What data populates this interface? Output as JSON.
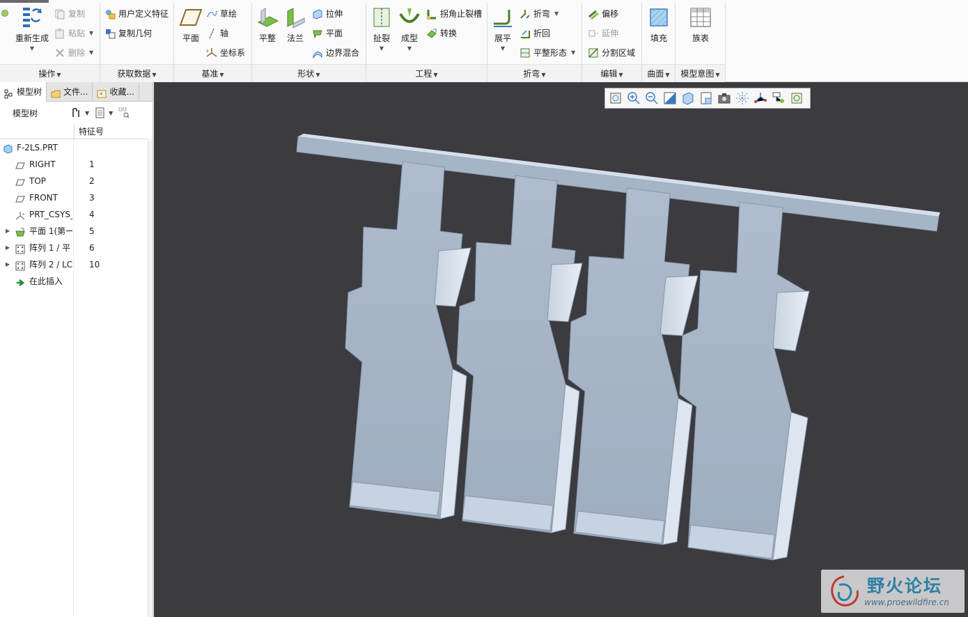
{
  "ribbon": {
    "groups": [
      {
        "label": "操作"
      },
      {
        "label": "获取数据"
      },
      {
        "label": "基准"
      },
      {
        "label": "形状"
      },
      {
        "label": "工程"
      },
      {
        "label": "折弯"
      },
      {
        "label": "编辑"
      },
      {
        "label": "曲面"
      },
      {
        "label": "模型意图"
      }
    ],
    "ops": {
      "regenerate": "重新生成",
      "copy": "复制",
      "paste": "粘贴",
      "delete": "删除"
    },
    "getdata": {
      "udf": "用户定义特征",
      "copy_geom": "复制几何"
    },
    "datum": {
      "plane": "平面",
      "sketch": "草绘",
      "axis": "轴",
      "csys": "坐标系"
    },
    "shapes": {
      "flat": "平整",
      "flange": "法兰",
      "extrude": "拉伸",
      "plane": "平面",
      "boundary_blend": "边界混合"
    },
    "engineering": {
      "rip": "扯裂",
      "form": "成型",
      "corner_relief": "拐角止裂槽",
      "convert": "转换"
    },
    "bend": {
      "unbend": "展平",
      "bend": "折弯",
      "bend_back": "折回",
      "flat_state": "平整形态"
    },
    "edit": {
      "offset": "偏移",
      "extend": "延伸",
      "split_area": "分割区域"
    },
    "surface": {
      "fill": "填充"
    },
    "intent": {
      "family_table": "族表"
    }
  },
  "panel": {
    "tabs": [
      "模型树",
      "文件...",
      "收藏..."
    ],
    "toolbar_label": "模型树",
    "column_header": "特征号",
    "items": [
      {
        "name": "F-2LS.PRT",
        "num": "",
        "icon": "part-icon"
      },
      {
        "name": "RIGHT",
        "num": "1",
        "icon": "datum-plane-icon"
      },
      {
        "name": "TOP",
        "num": "2",
        "icon": "datum-plane-icon"
      },
      {
        "name": "FRONT",
        "num": "3",
        "icon": "datum-plane-icon"
      },
      {
        "name": "PRT_CSYS_",
        "num": "4",
        "icon": "csys-icon"
      },
      {
        "name": "平面 1(第一",
        "num": "5",
        "icon": "flat-wall-icon"
      },
      {
        "name": "阵列 1 / 平",
        "num": "6",
        "icon": "pattern-icon"
      },
      {
        "name": "阵列 2 / LC",
        "num": "10",
        "icon": "pattern-icon"
      },
      {
        "name": "在此插入",
        "num": "",
        "icon": "insert-here-arrow-icon"
      }
    ]
  },
  "viewport": {
    "background": "#3b3b40",
    "model_color": "#a9b8c9",
    "watermark_title": "野火论坛",
    "watermark_url": "www.proewildfire.cn"
  }
}
